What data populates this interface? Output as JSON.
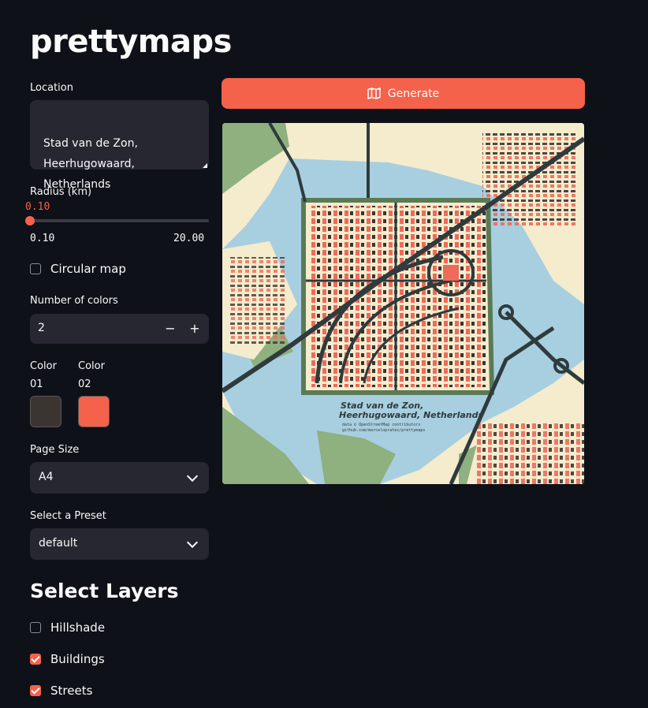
{
  "app": {
    "title": "prettymaps"
  },
  "location": {
    "label": "Location",
    "value": "Stad van de Zon,\nHeerhugowaard,\nNetherlands"
  },
  "radius": {
    "label": "Radius (km)",
    "value": "0.10",
    "min": "0.10",
    "max": "20.00",
    "fraction": 0
  },
  "circular": {
    "label": "Circular map",
    "checked": false
  },
  "num_colors": {
    "label": "Number of colors",
    "value": "2",
    "minus": "−",
    "plus": "+"
  },
  "colors": [
    {
      "label_line1": "Color",
      "label_line2": "01",
      "hex": "#3c3431"
    },
    {
      "label_line1": "Color",
      "label_line2": "02",
      "hex": "#f4624c"
    }
  ],
  "page_size": {
    "label": "Page Size",
    "value": "A4"
  },
  "preset": {
    "label": "Select a Preset",
    "value": "default"
  },
  "layers": {
    "title": "Select Layers",
    "items": [
      {
        "label": "Hillshade",
        "checked": false
      },
      {
        "label": "Buildings",
        "checked": true
      },
      {
        "label": "Streets",
        "checked": true
      }
    ]
  },
  "generate": {
    "label": "Generate",
    "icon": "map-icon"
  },
  "map": {
    "caption_title_1": "Stad van de Zon,",
    "caption_title_2": "Heerhugowaard, Netherlands",
    "credit_1": "data © OpenStreetMap contributors",
    "credit_2": "github.com/marceloprates/prettymaps",
    "palette": {
      "water": "#a8cfe0",
      "land": "#f4eccd",
      "park": "#8fb07f",
      "road": "#2f3b3c",
      "building_a": "#ee6a5a",
      "building_b": "#3c3431"
    }
  }
}
